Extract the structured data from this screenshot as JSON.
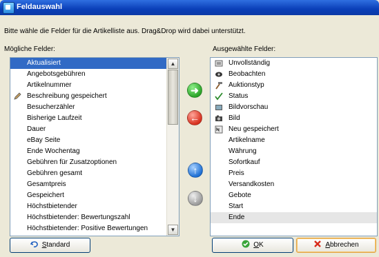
{
  "window": {
    "title": "Feldauswahl"
  },
  "instruction": "Bitte wähle die Felder für die Artikelliste aus. Drag&Drop wird dabei unterstützt.",
  "available": {
    "label": "Mögliche Felder:",
    "items": [
      {
        "label": "Aktualisiert",
        "icon": ""
      },
      {
        "label": "Angebotsgebühren",
        "icon": ""
      },
      {
        "label": "Artikelnummer",
        "icon": ""
      },
      {
        "label": "Beschreibung gespeichert",
        "icon": "pencil-icon"
      },
      {
        "label": "Besucherzähler",
        "icon": ""
      },
      {
        "label": "Bisherige Laufzeit",
        "icon": ""
      },
      {
        "label": "Dauer",
        "icon": ""
      },
      {
        "label": "eBay Seite",
        "icon": ""
      },
      {
        "label": "Ende Wochentag",
        "icon": ""
      },
      {
        "label": "Gebühren für Zusatzoptionen",
        "icon": ""
      },
      {
        "label": "Gebühren gesamt",
        "icon": ""
      },
      {
        "label": "Gesamtpreis",
        "icon": ""
      },
      {
        "label": "Gespeichert",
        "icon": ""
      },
      {
        "label": "Höchstbietender",
        "icon": ""
      },
      {
        "label": "Höchstbietender: Bewertungszahl",
        "icon": ""
      },
      {
        "label": "Höchstbietender: Positive Bewertungen",
        "icon": ""
      }
    ]
  },
  "selected_fields": {
    "label": "Ausgewählte Felder:",
    "items": [
      {
        "label": "Unvollständig",
        "icon": "incomplete-icon"
      },
      {
        "label": "Beobachten",
        "icon": "watch-icon"
      },
      {
        "label": "Auktionstyp",
        "icon": "hammer-icon"
      },
      {
        "label": "Status",
        "icon": "check-icon"
      },
      {
        "label": "Bildvorschau",
        "icon": "image-preview-icon"
      },
      {
        "label": "Bild",
        "icon": "camera-icon"
      },
      {
        "label": "Neu gespeichert",
        "icon": "new-saved-icon"
      },
      {
        "label": "Artikelname",
        "icon": ""
      },
      {
        "label": "Währung",
        "icon": ""
      },
      {
        "label": "Sofortkauf",
        "icon": ""
      },
      {
        "label": "Preis",
        "icon": ""
      },
      {
        "label": "Versandkosten",
        "icon": ""
      },
      {
        "label": "Gebote",
        "icon": ""
      },
      {
        "label": "Start",
        "icon": ""
      },
      {
        "label": "Ende",
        "icon": ""
      }
    ]
  },
  "buttons": {
    "standard_key": "S",
    "standard_rest": "tandard",
    "ok_key": "O",
    "ok_rest": "K",
    "cancel_key": "A",
    "cancel_rest": "bbrechen"
  },
  "colors": {
    "selection": "#316ac5",
    "titlebar": "#0a3fb8"
  }
}
